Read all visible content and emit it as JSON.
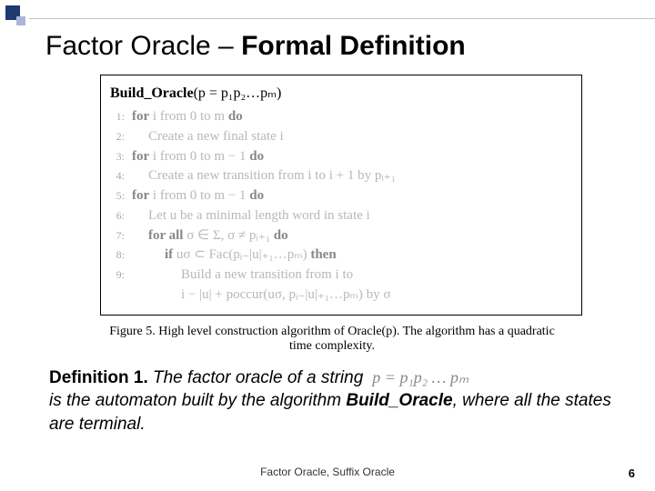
{
  "title": {
    "plain": "Factor Oracle – ",
    "bold": "Formal Definition"
  },
  "algorithm": {
    "head_fn": "Build_Oracle",
    "head_arg": "(p = p₁p₂…pₘ)",
    "lines": [
      {
        "n": "1:",
        "indent": 0,
        "text_a": "for",
        "text_b": " i from 0 to m ",
        "text_c": "do"
      },
      {
        "n": "2:",
        "indent": 1,
        "text_a": "",
        "text_b": "Create a new final state i",
        "text_c": ""
      },
      {
        "n": "3:",
        "indent": 0,
        "text_a": "for",
        "text_b": " i from 0 to m − 1 ",
        "text_c": "do"
      },
      {
        "n": "4:",
        "indent": 1,
        "text_a": "",
        "text_b": "Create a new transition from i to i + 1 by pᵢ₊₁",
        "text_c": ""
      },
      {
        "n": "5:",
        "indent": 0,
        "text_a": "for",
        "text_b": " i from 0 to m − 1 ",
        "text_c": "do"
      },
      {
        "n": "6:",
        "indent": 1,
        "text_a": "",
        "text_b": "Let u be a minimal length word in state i",
        "text_c": ""
      },
      {
        "n": "7:",
        "indent": 1,
        "text_a": "for all",
        "text_b": " σ ∈ Σ, σ ≠ pᵢ₊₁ ",
        "text_c": "do"
      },
      {
        "n": "8:",
        "indent": 2,
        "text_a": "if",
        "text_b": " uσ ⊂ Fac(pᵢ₋|u|₊₁…pₘ) ",
        "text_c": "then"
      },
      {
        "n": "9:",
        "indent": 3,
        "text_a": "",
        "text_b": "Build a new transition from i to",
        "text_c": ""
      },
      {
        "n": "",
        "indent": 3,
        "text_a": "",
        "text_b": "i − |u| + poccur(uσ, pᵢ₋|u|₊₁…pₘ) by σ",
        "text_c": ""
      }
    ]
  },
  "caption": "Figure 5. High level construction algorithm of Oracle(p). The algorithm has a quadratic time complexity.",
  "definition": {
    "label": "Definition 1.",
    "line1_ital": " The factor oracle of a string",
    "formula": "p = p₁p₂ … pₘ",
    "line2": "is the automaton built by the algorithm ",
    "build": "Build_Oracle",
    "line2_tail": ", where all the states are terminal."
  },
  "footer": "Factor Oracle, Suffix Oracle",
  "page": "6"
}
